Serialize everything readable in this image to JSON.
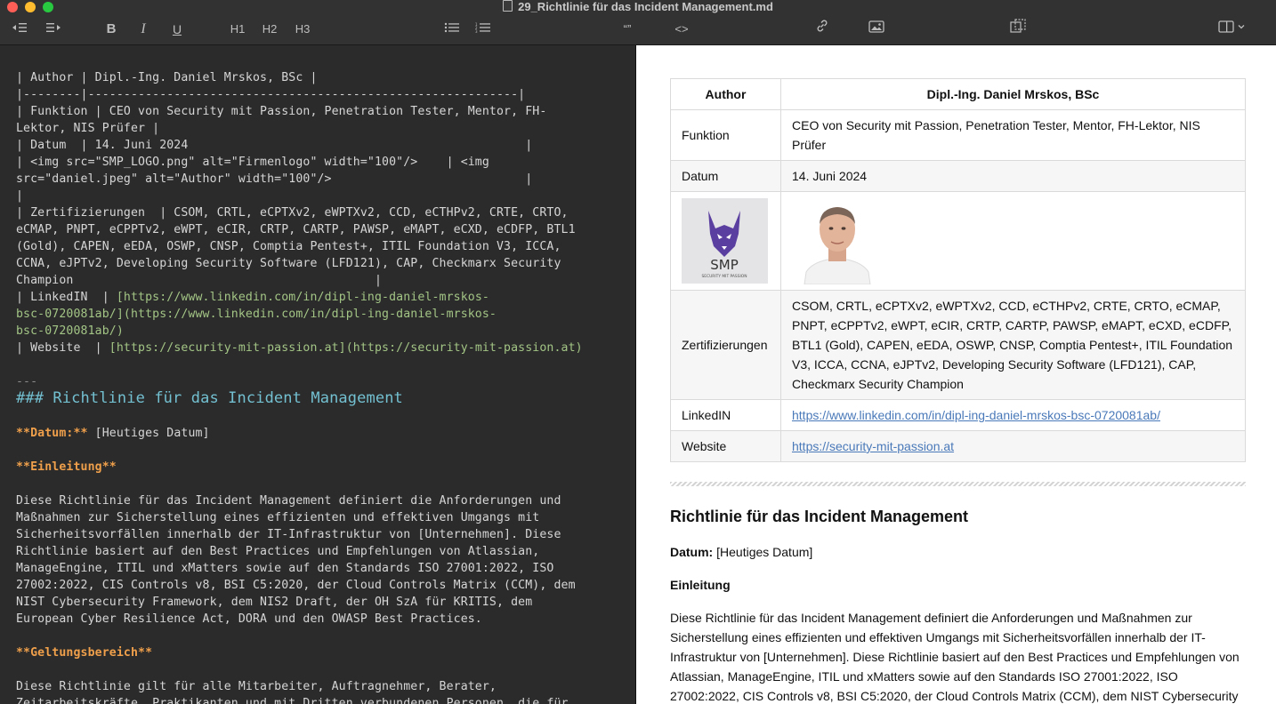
{
  "window": {
    "title": "29_Richtlinie für das Incident Management.md"
  },
  "toolbar": {
    "bold": "B",
    "italic": "I",
    "underline": "U",
    "h1": "H1",
    "h2": "H2",
    "h3": "H3",
    "quote": "“”",
    "code": "<>"
  },
  "editor": {
    "line1": "| Author | Dipl.-Ing. Daniel Mrskos, BSc |",
    "line2": "|--------|------------------------------------------------------------|",
    "line3": "| Funktion | CEO von Security mit Passion, Penetration Tester, Mentor, FH-",
    "line4": "Lektor, NIS Prüfer |",
    "line5": "| Datum  | 14. Juni 2024                                               |",
    "line6": "| <img src=\"SMP_LOGO.png\" alt=\"Firmenlogo\" width=\"100\"/>    | <img",
    "line7": "src=\"daniel.jpeg\" alt=\"Author\" width=\"100\"/>                           |",
    "line8": "|",
    "line9": "| Zertifizierungen  | CSOM, CRTL, eCPTXv2, eWPTXv2, CCD, eCTHPv2, CRTE, CRTO,",
    "line10": "eCMAP, PNPT, eCPPTv2, eWPT, eCIR, CRTP, CARTP, PAWSP, eMAPT, eCXD, eCDFP, BTL1",
    "line11": "(Gold), CAPEN, eEDA, OSWP, CNSP, Comptia Pentest+, ITIL Foundation V3, ICCA,",
    "line12": "CCNA, eJPTv2, Developing Security Software (LFD121), CAP, Checkmarx Security",
    "line13": "Champion                                          |",
    "line14a": "| LinkedIN  | ",
    "line14b": "[https://www.linkedin.com/in/dipl-ing-daniel-mrskos-",
    "line15": "bsc-0720081ab/](https://www.linkedin.com/in/dipl-ing-daniel-mrskos-",
    "line16": "bsc-0720081ab/)",
    "line17a": "| Website  | ",
    "line17b": "[https://security-mit-passion.at](https://security-mit-passion.at)",
    "line18": "---",
    "h3": "### Richtlinie für das Incident Management",
    "datum_label": "**Datum:**",
    "datum_value": " [Heutiges Datum]",
    "einleitung": "**Einleitung**",
    "p1": "Diese Richtlinie für das Incident Management definiert die Anforderungen und",
    "p2": "Maßnahmen zur Sicherstellung eines effizienten und effektiven Umgangs mit",
    "p3": "Sicherheitsvorfällen innerhalb der IT-Infrastruktur von [Unternehmen]. Diese",
    "p4": "Richtlinie basiert auf den Best Practices und Empfehlungen von Atlassian,",
    "p5": "ManageEngine, ITIL und xMatters sowie auf den Standards ISO 27001:2022, ISO",
    "p6": "27002:2022, CIS Controls v8, BSI C5:2020, der Cloud Controls Matrix (CCM), dem",
    "p7": "NIST Cybersecurity Framework, dem NIS2 Draft, der OH SzA für KRITIS, dem",
    "p8": "European Cyber Resilience Act, DORA und den OWASP Best Practices.",
    "geltung": "**Geltungsbereich**",
    "g1": "Diese Richtlinie gilt für alle Mitarbeiter, Auftragnehmer, Berater,",
    "g2": "Zeitarbeitskräfte, Praktikanten und mit Dritten verbundenen Personen, die für"
  },
  "preview": {
    "table": {
      "header_label": "Author",
      "header_value": "Dipl.-Ing. Daniel Mrskos, BSc",
      "funktion_label": "Funktion",
      "funktion_value": "CEO von Security mit Passion, Penetration Tester, Mentor, FH-Lektor, NIS Prüfer",
      "datum_label": "Datum",
      "datum_value": "14. Juni 2024",
      "logo_text": "SMP",
      "logo_sub": "SECURITY MIT PASSION",
      "zert_label": "Zertifizierungen",
      "zert_value": "CSOM, CRTL, eCPTXv2, eWPTXv2, CCD, eCTHPv2, CRTE, CRTO, eCMAP, PNPT, eCPPTv2, eWPT, eCIR, CRTP, CARTP, PAWSP, eMAPT, eCXD, eCDFP, BTL1 (Gold), CAPEN, eEDA, OSWP, CNSP, Comptia Pentest+, ITIL Foundation V3, ICCA, CCNA, eJPTv2, Developing Security Software (LFD121), CAP, Checkmarx Security Champion",
      "linkedin_label": "LinkedIN",
      "linkedin_value": "https://www.linkedin.com/in/dipl-ing-daniel-mrskos-bsc-0720081ab/",
      "website_label": "Website",
      "website_value": "https://security-mit-passion.at"
    },
    "heading": "Richtlinie für das Incident Management",
    "datum_label": "Datum:",
    "datum_value": " [Heutiges Datum]",
    "einleitung": "Einleitung",
    "paragraph": "Diese Richtlinie für das Incident Management definiert die Anforderungen und Maßnahmen zur Sicherstellung eines effizienten und effektiven Umgangs mit Sicherheitsvorfällen innerhalb der IT-Infrastruktur von [Unternehmen]. Diese Richtlinie basiert auf den Best Practices und Empfehlungen von Atlassian, ManageEngine, ITIL und xMatters sowie auf den Standards ISO 27001:2022, ISO 27002:2022, CIS Controls v8, BSI C5:2020, der Cloud Controls Matrix (CCM), dem NIST Cybersecurity"
  }
}
